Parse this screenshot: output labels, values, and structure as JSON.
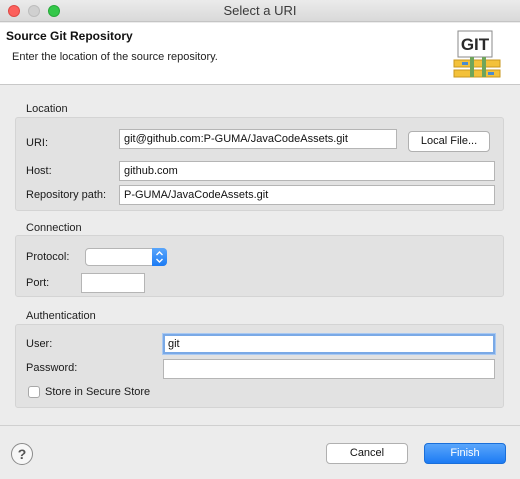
{
  "window": {
    "title": "Select a URI"
  },
  "header": {
    "title": "Source Git Repository",
    "description": "Enter the location of the source repository.",
    "logo_text": "GIT"
  },
  "location": {
    "label": "Location",
    "uri_label": "URI:",
    "uri_value": "git@github.com:P-GUMA/JavaCodeAssets.git",
    "local_file_button": "Local File...",
    "host_label": "Host:",
    "host_value": "github.com",
    "repo_path_label": "Repository path:",
    "repo_path_value": "P-GUMA/JavaCodeAssets.git"
  },
  "connection": {
    "label": "Connection",
    "protocol_label": "Protocol:",
    "protocol_value": "",
    "port_label": "Port:",
    "port_value": ""
  },
  "authentication": {
    "label": "Authentication",
    "user_label": "User:",
    "user_value": "git",
    "password_label": "Password:",
    "password_value": "",
    "store_label": "Store in Secure Store",
    "store_checked": false
  },
  "footer": {
    "help_icon": "?",
    "cancel_label": "Cancel",
    "finish_label": "Finish"
  },
  "colors": {
    "accent": "#1c7bf4",
    "group_bg": "#e2e2e2",
    "window_bg": "#ececec"
  }
}
